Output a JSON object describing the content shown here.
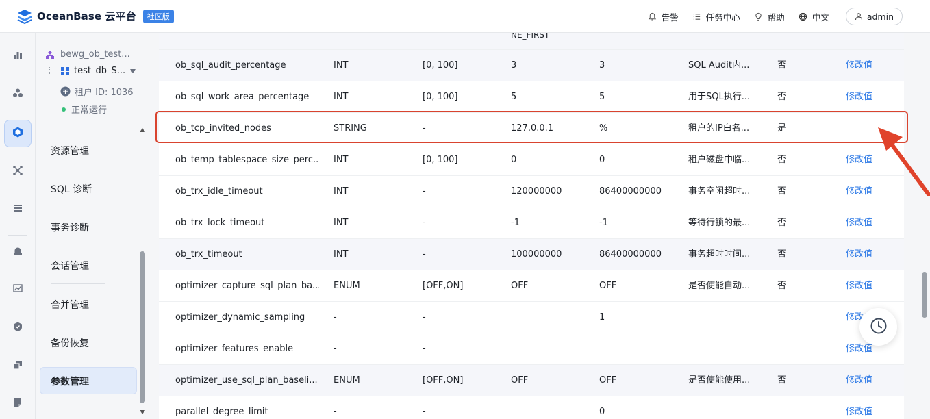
{
  "header": {
    "brand": "OceanBase 云平台",
    "edition": "社区版",
    "actions": [
      {
        "label": "告警",
        "icon": "bell-icon"
      },
      {
        "label": "任务中心",
        "icon": "task-list-icon"
      },
      {
        "label": "帮助",
        "icon": "lightbulb-icon"
      },
      {
        "label": "中文",
        "icon": "globe-icon"
      }
    ],
    "user": "admin"
  },
  "tenant": {
    "cluster": "bewg_ob_test...",
    "database": "test_db_S...",
    "tenant_id": "租户 ID: 1036",
    "status": "正常运行"
  },
  "menu": {
    "items": [
      "资源管理",
      "SQL 诊断",
      "事务诊断",
      "会话管理",
      "合并管理",
      "备份恢复",
      "参数管理"
    ],
    "active": "参数管理"
  },
  "table": {
    "top_partial": "NE_FIRST",
    "rows": [
      {
        "name": "ob_sql_audit_percentage",
        "type": "INT",
        "range": "[0, 100]",
        "default": "3",
        "current": "3",
        "desc": "SQL Audit内...",
        "restart": "否",
        "action": "修改值"
      },
      {
        "name": "ob_sql_work_area_percentage",
        "type": "INT",
        "range": "[0, 100]",
        "default": "5",
        "current": "5",
        "desc": "用于SQL执行...",
        "restart": "否",
        "action": "修改值"
      },
      {
        "name": "ob_tcp_invited_nodes",
        "type": "STRING",
        "range": "-",
        "default": "127.0.0.1",
        "current": "%",
        "desc": "租户的IP白名...",
        "restart": "是",
        "action": ""
      },
      {
        "name": "ob_temp_tablespace_size_perc...",
        "type": "INT",
        "range": "[0, 100]",
        "default": "0",
        "current": "0",
        "desc": "租户磁盘中临...",
        "restart": "否",
        "action": "修改值"
      },
      {
        "name": "ob_trx_idle_timeout",
        "type": "INT",
        "range": "-",
        "default": "120000000",
        "current": "86400000000",
        "desc": "事务空闲超时...",
        "restart": "否",
        "action": "修改值"
      },
      {
        "name": "ob_trx_lock_timeout",
        "type": "INT",
        "range": "-",
        "default": "-1",
        "current": "-1",
        "desc": "等待行锁的最...",
        "restart": "否",
        "action": "修改值"
      },
      {
        "name": "ob_trx_timeout",
        "type": "INT",
        "range": "-",
        "default": "100000000",
        "current": "86400000000",
        "desc": "事务超时时间...",
        "restart": "否",
        "action": "修改值"
      },
      {
        "name": "optimizer_capture_sql_plan_ba...",
        "type": "ENUM",
        "range": "[OFF,ON]",
        "default": "OFF",
        "current": "OFF",
        "desc": "是否使能自动...",
        "restart": "否",
        "action": "修改值"
      },
      {
        "name": "optimizer_dynamic_sampling",
        "type": "-",
        "range": "-",
        "default": "",
        "current": "1",
        "desc": "",
        "restart": "",
        "action": "修改值"
      },
      {
        "name": "optimizer_features_enable",
        "type": "-",
        "range": "-",
        "default": "",
        "current": "",
        "desc": "",
        "restart": "",
        "action": "修改值"
      },
      {
        "name": "optimizer_use_sql_plan_baseli...",
        "type": "ENUM",
        "range": "[OFF,ON]",
        "default": "OFF",
        "current": "OFF",
        "desc": "是否使能使用...",
        "restart": "否",
        "action": "修改值"
      },
      {
        "name": "parallel_degree_limit",
        "type": "-",
        "range": "-",
        "default": "",
        "current": "0",
        "desc": "",
        "restart": "",
        "action": "修改值"
      }
    ]
  },
  "colors": {
    "accent": "#2e7ae6",
    "highlight_border": "#d9442f",
    "arrow": "#e0432b"
  }
}
